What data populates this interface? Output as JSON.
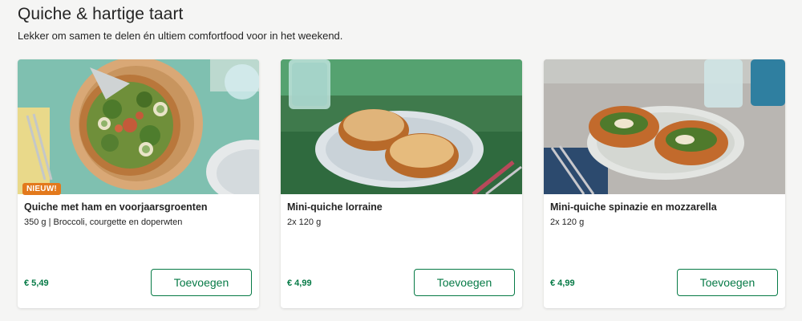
{
  "section": {
    "title": "Quiche & hartige taart",
    "subtitle": "Lekker om samen te delen én ultiem comfortfood voor in het weekend."
  },
  "cards": [
    {
      "badge": "NIEUW!",
      "title": "Quiche met ham en voorjaarsgroenten",
      "description": "350 g | Broccoli, courgette en doperwten",
      "price": "€ 5,49",
      "button_label": "Toevoegen"
    },
    {
      "title": "Mini-quiche lorraine",
      "description": "2x 120 g",
      "price": "€ 4,99",
      "button_label": "Toevoegen"
    },
    {
      "title": "Mini-quiche spinazie en mozzarella",
      "description": "2x 120 g",
      "price": "€ 4,99",
      "button_label": "Toevoegen"
    }
  ],
  "colors": {
    "accent_green": "#067a46",
    "badge_orange": "#e3791c",
    "page_background": "#f5f5f4"
  }
}
